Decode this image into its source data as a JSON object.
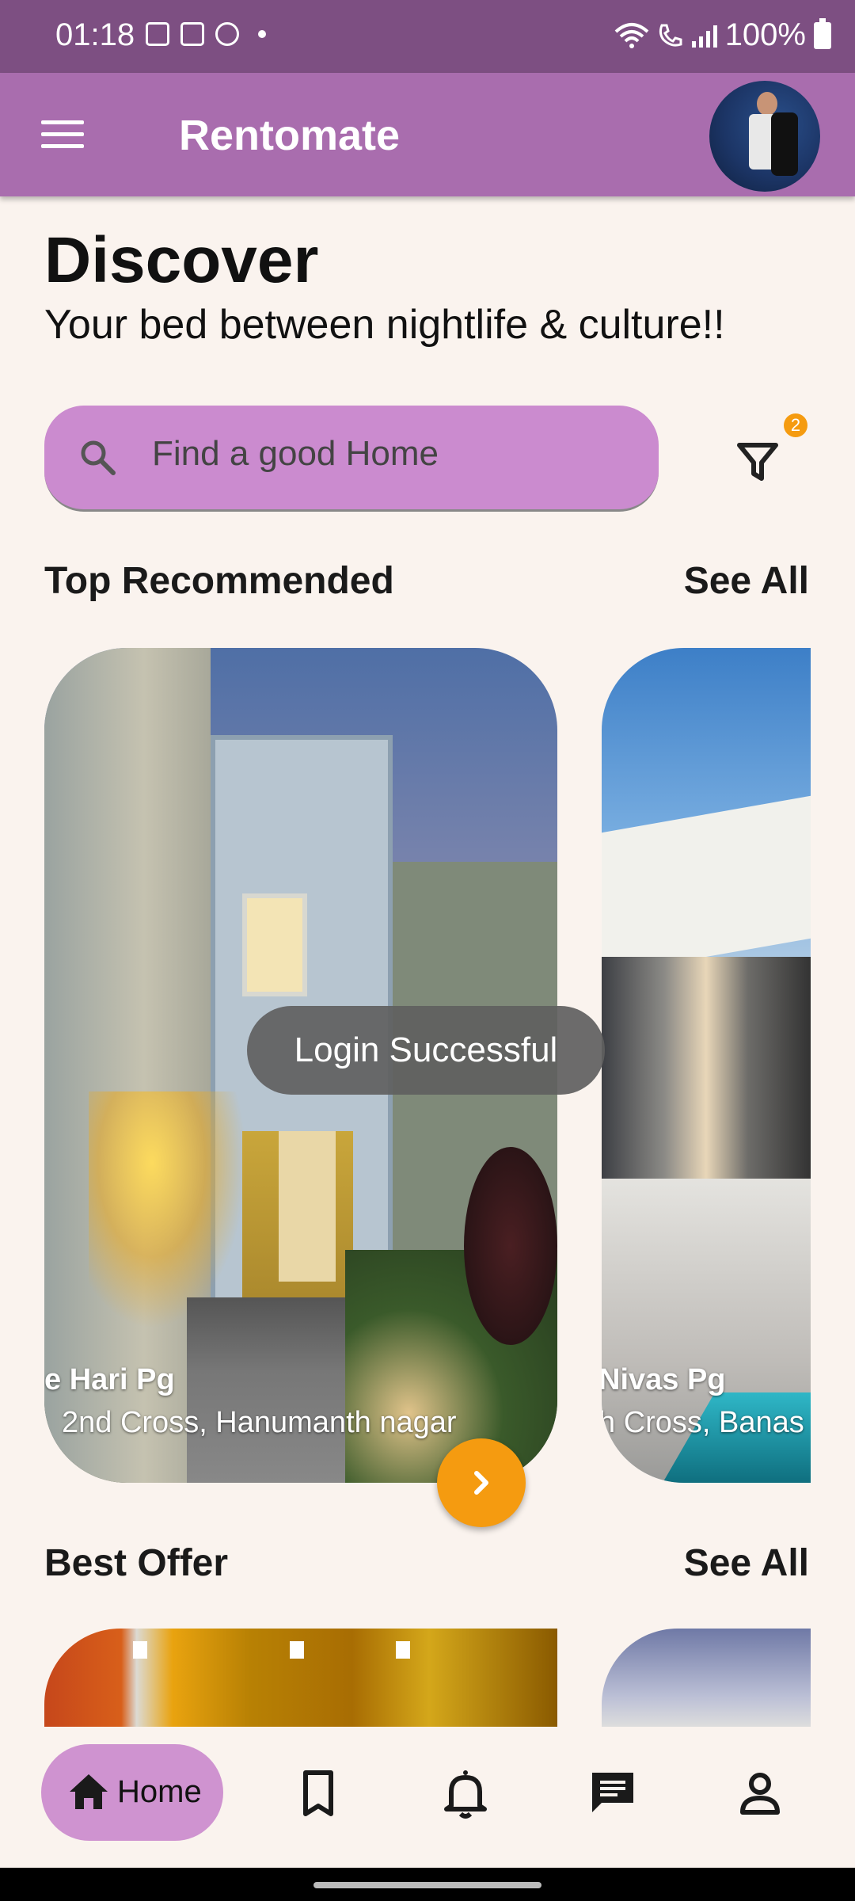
{
  "status_bar": {
    "time": "01:18",
    "battery": "100%"
  },
  "app_bar": {
    "title": "Rentomate",
    "menu_icon": "menu-icon",
    "avatar_icon": "avatar"
  },
  "header": {
    "title": "Discover",
    "subtitle": "Your bed between nightlife & culture!!"
  },
  "search": {
    "placeholder": "Find a good Home",
    "filter_badge": "2"
  },
  "top_recommended": {
    "title": "Top Recommended",
    "see_all": "See All",
    "cards": [
      {
        "name": "e Hari Pg",
        "address": "2nd Cross, Hanumanth nagar"
      },
      {
        "name": "Nivas Pg",
        "address": "h Cross, Banas"
      }
    ]
  },
  "toast": "Login Successful",
  "best_offer": {
    "title": "Best Offer",
    "see_all": "See All"
  },
  "bottom_nav": {
    "items": [
      {
        "label": "Home",
        "icon": "home-icon",
        "active": true
      },
      {
        "icon": "bookmark-icon"
      },
      {
        "icon": "bell-icon"
      },
      {
        "icon": "chat-icon"
      },
      {
        "icon": "person-icon"
      }
    ]
  },
  "colors": {
    "status_bar": "#7d4f82",
    "app_bar": "#a96dae",
    "search_bg": "#cb8bcf",
    "accent": "#f59b10",
    "nav_active": "#cf93d0",
    "background": "#faf3ee"
  }
}
